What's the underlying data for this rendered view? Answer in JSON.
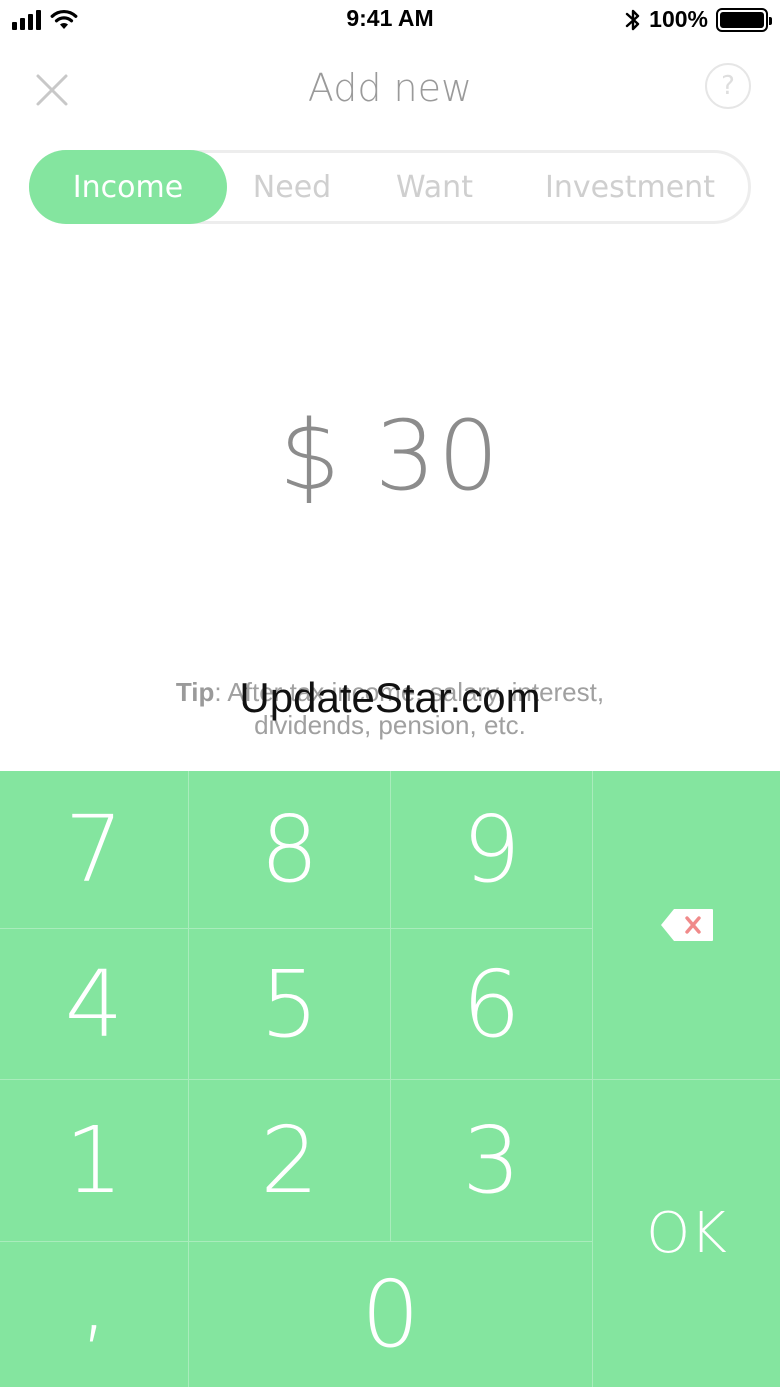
{
  "status_bar": {
    "time": "9:41 AM",
    "battery_text": "100%",
    "battery_level": 1.0,
    "signal_bars": 4,
    "icons": [
      "signal-bars-icon",
      "wifi-icon",
      "bluetooth-icon",
      "battery-icon"
    ]
  },
  "header": {
    "title": "Add new",
    "close_icon": "close-icon",
    "help_label": "?"
  },
  "segments": {
    "items": [
      {
        "label": "Income",
        "active": true
      },
      {
        "label": "Need",
        "active": false
      },
      {
        "label": "Want",
        "active": false
      },
      {
        "label": "Investment",
        "active": false
      }
    ]
  },
  "amount": {
    "text": "$ 30"
  },
  "tip": {
    "label": "Tip",
    "text": ": After tax income, salary, interest, dividends, pension, etc."
  },
  "watermark": {
    "text": "UpdateStar.com"
  },
  "keypad": {
    "keys": {
      "k7": "7",
      "k8": "8",
      "k9": "9",
      "k4": "4",
      "k5": "5",
      "k6": "6",
      "k1": "1",
      "k2": "2",
      "k3": "3",
      "comma": ",",
      "k0": "0"
    },
    "ok_label": "OK",
    "backspace_icon": "backspace-icon"
  },
  "colors": {
    "accent": "#84e59f",
    "backspace_x": "#f08a8a"
  }
}
